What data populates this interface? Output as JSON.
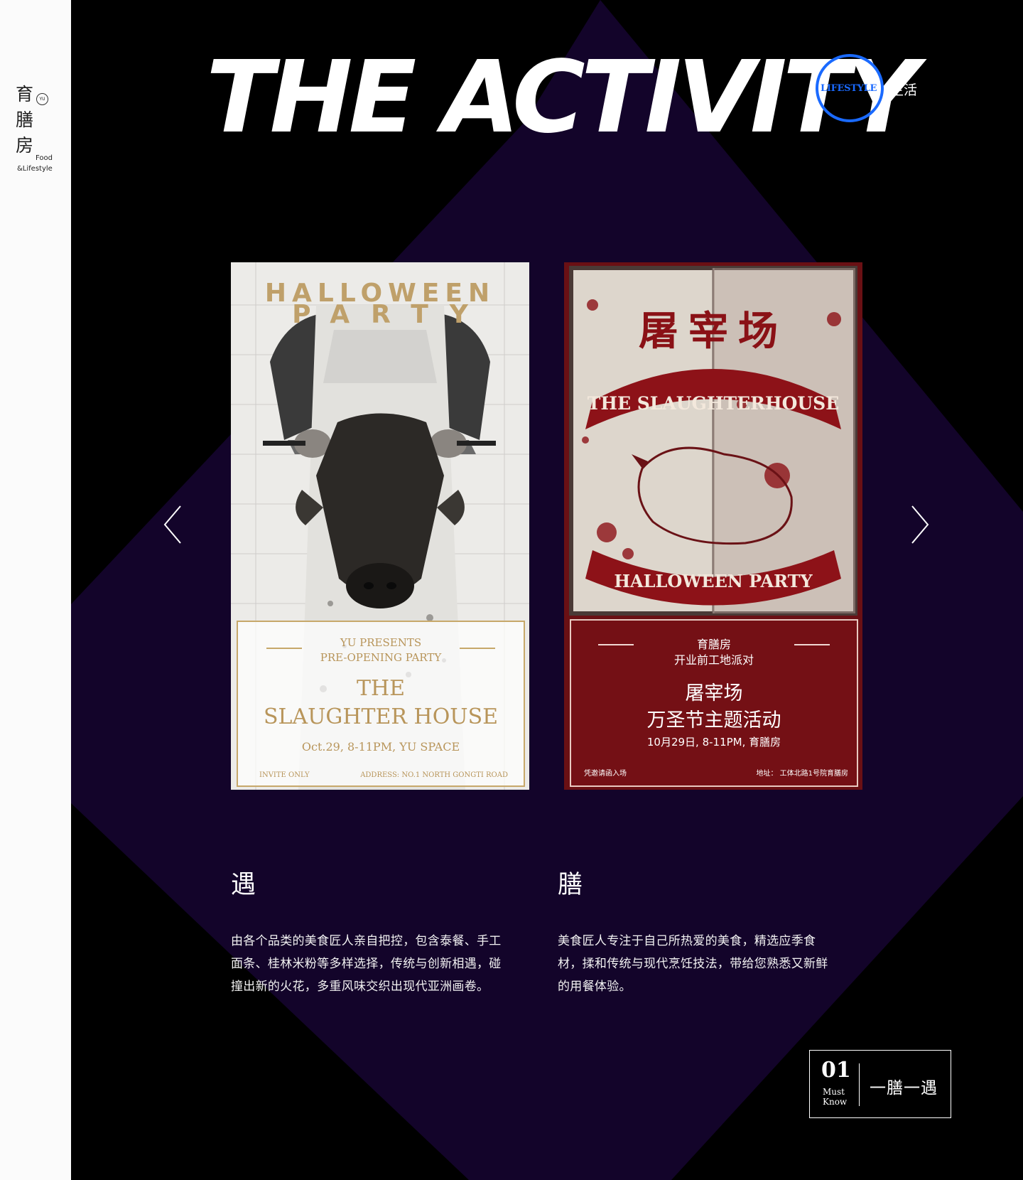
{
  "logo": {
    "cn_chars": [
      "育",
      "膳",
      "房"
    ],
    "seal": "YU",
    "en_line1": "Food",
    "en_line2": "&Lifestyle"
  },
  "header": {
    "title": "THE ACTIVITY",
    "lifestyle_en": "LIFESTYLE",
    "lifestyle_cn": "生活"
  },
  "carousel": {
    "prev_icon": "chevron-left-icon",
    "next_icon": "chevron-right-icon",
    "posters": [
      {
        "title_line1": "HALLOWEEN",
        "title_line2": "PARTY",
        "presents": "YU PRESENTS",
        "subtitle": "PRE-OPENING PARTY",
        "name_line1": "THE",
        "name_line2": "SLAUGHTER HOUSE",
        "date": "Oct.29, 8-11PM, YU SPACE",
        "footer_left": "INVITE ONLY",
        "footer_right": "ADDRESS: NO.1 NORTH GONGTI ROAD"
      },
      {
        "title_cn": "屠宰场",
        "banner_top": "THE SLAUGHTERHOUSE",
        "banner_bottom": "HALLOWEEN PARTY",
        "brand": "育膳房",
        "subtitle": "开业前工地派对",
        "name_line1": "屠宰场",
        "name_line2": "万圣节主题活动",
        "date": "10月29日, 8-11PM, 育膳房",
        "footer_left": "凭邀请函入场",
        "footer_right": "地址： 工体北路1号院育膳房"
      }
    ]
  },
  "sections": [
    {
      "heading": "遇",
      "body": "由各个品类的美食匠人亲自把控，包含泰餐、手工面条、桂林米粉等多样选择，传统与创新相遇，碰撞出新的火花，多重风味交织出现代亚洲画卷。"
    },
    {
      "heading": "膳",
      "body": "美食匠人专注于自己所热爱的美食，精选应季食材，揉和传统与现代烹饪技法，带给您熟悉又新鲜的用餐体验。"
    }
  ],
  "must_know": {
    "number": "01",
    "label_line1": "Must",
    "label_line2": "Know",
    "title": "一膳一遇"
  },
  "colors": {
    "diamond": "#13042a",
    "accent_blue": "#1a6aff",
    "poster_gold": "#bfa06a",
    "poster_red": "#741015"
  }
}
